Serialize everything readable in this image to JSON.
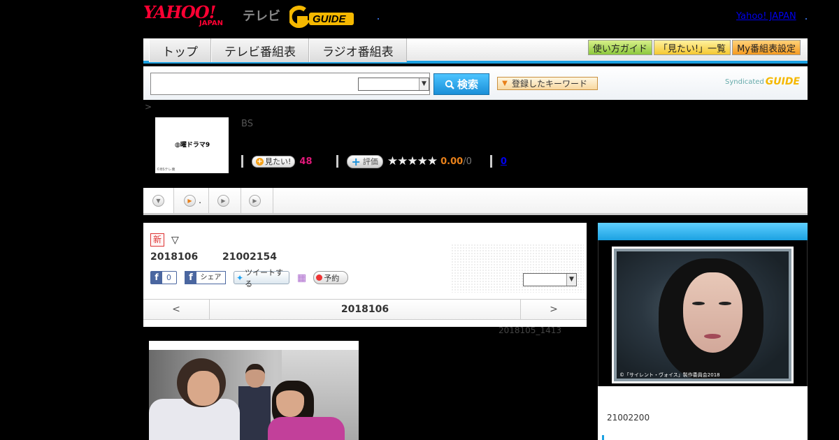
{
  "header": {
    "yahoo_logo": "YAHOO!",
    "japan_logo": "JAPAN",
    "tv_label": "テレビ",
    "gguide_logo": "G GUIDE",
    "yahoo_japan_link": "Yahoo! JAPAN"
  },
  "nav": {
    "tabs": [
      {
        "label": "トップ"
      },
      {
        "label": "テレビ番組表"
      },
      {
        "label": "ラジオ番組表"
      }
    ],
    "right_buttons": [
      {
        "label": "使い方ガイド",
        "color": "#8cc83c"
      },
      {
        "label": "「見たい!」一覧",
        "color": "#f5c830"
      },
      {
        "label": "My番組表設定",
        "color": "#f59a20"
      }
    ]
  },
  "search": {
    "input_value": "",
    "select_value": "",
    "button_label": "検索",
    "keyword_button": "登録したキーワード",
    "syndicated_label": "Syndicated",
    "syndicated_logo": "GUIDE"
  },
  "breadcrumb": ">",
  "program": {
    "thumb_title": "◍曜ドラマ9",
    "thumb_copyright": "©BSテレ東",
    "channel": "BS",
    "mitai_label": "見たい!",
    "mitai_count": "48",
    "hyoka_label": "評価",
    "stars": "★★★★★",
    "score": "0.00",
    "score_sub": "/0",
    "review_count": "0"
  },
  "tabstrip": {
    "tabs": [
      {
        "icon": "chevron-down-icon"
      },
      {
        "icon": "play-icon",
        "label": "."
      },
      {
        "icon": "play-icon",
        "label": ""
      },
      {
        "icon": "play-icon",
        "label": ""
      }
    ]
  },
  "episode": {
    "new_badge": "新",
    "toggle": "▽",
    "date": "2018106",
    "id": "21002154",
    "fb_like_count": "0",
    "fb_share": "シェア",
    "tweet": "ツイートする",
    "reserve": "予約",
    "select_value": "",
    "pager_prev": "<",
    "pager_title": "2018106",
    "pager_next": ">",
    "updated": "2018105_1413"
  },
  "side": {
    "image_copyright": "©「サイレント・ヴォイス」製作委員会2018",
    "program_id": "21002200"
  },
  "colors": {
    "accent_blue": "#1ba1e2",
    "pink_count": "#e0197a",
    "score_orange": "#e8801a",
    "yahoo_red": "#ff0033"
  }
}
